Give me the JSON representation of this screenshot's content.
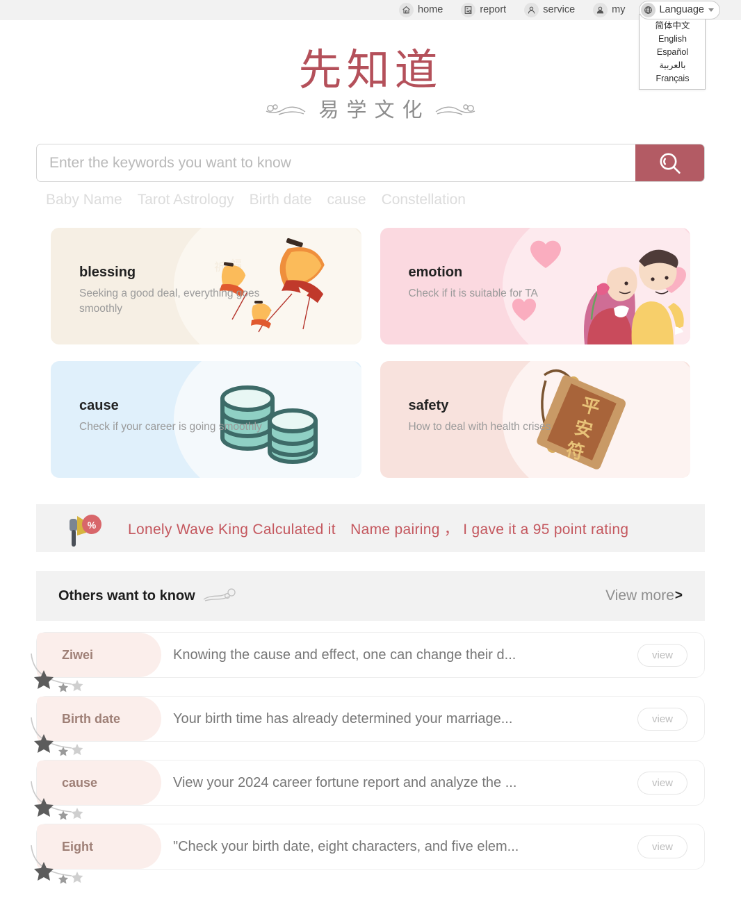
{
  "topnav": {
    "items": [
      {
        "label": "home",
        "icon": "home-icon"
      },
      {
        "label": "report",
        "icon": "report-icon"
      },
      {
        "label": "service",
        "icon": "service-icon"
      },
      {
        "label": "my",
        "icon": "user-icon"
      }
    ],
    "language": {
      "label": "Language",
      "icon": "globe-icon",
      "expanded": true,
      "options": [
        "简体中文",
        "English",
        "Español",
        "بالعربية",
        "Français"
      ]
    }
  },
  "logo": {
    "main": "先知道",
    "sub": "易学文化"
  },
  "search": {
    "placeholder": "Enter the keywords you want to know",
    "value": "",
    "button_icon": "search-icon",
    "accent": "#b35b64"
  },
  "tags": [
    "Baby Name",
    "Tarot Astrology",
    "Birth date",
    "cause",
    "Constellation"
  ],
  "cards": [
    {
      "title": "blessing",
      "desc": "Seeking a good deal, everything goes smoothly",
      "art": "lanterns",
      "bg": "#f6efe4"
    },
    {
      "title": "emotion",
      "desc": "Check if it is suitable for TA",
      "art": "couple-hearts",
      "bg": "#fbd9e0"
    },
    {
      "title": "cause",
      "desc": "Check if your career is going smoothly",
      "art": "coins",
      "bg": "#e0f0fb"
    },
    {
      "title": "safety",
      "desc": "How to deal with health crises",
      "art": "amulet",
      "bg": "#f8e2dd"
    }
  ],
  "notice": {
    "icon": "megaphone-percent-icon",
    "text": "Lonely Wave King Calculated it　Name pairing ， I gave it a 95 point rating",
    "color": "#c4575e"
  },
  "others": {
    "title": "Others want to know",
    "ornament": "cloud-swirl-icon",
    "view_more": "View more",
    "chevron": "›"
  },
  "list": {
    "view_label": "view",
    "rows": [
      {
        "tag": "Ziwei",
        "desc": "Knowing the cause and effect, one can change their d..."
      },
      {
        "tag": "Birth date",
        "desc": "Your birth time has already determined your marriage..."
      },
      {
        "tag": "cause",
        "desc": "View your 2024 career fortune report and analyze the ..."
      },
      {
        "tag": "Eight",
        "desc": "\"Check your birth date, eight characters, and five elem..."
      }
    ]
  }
}
